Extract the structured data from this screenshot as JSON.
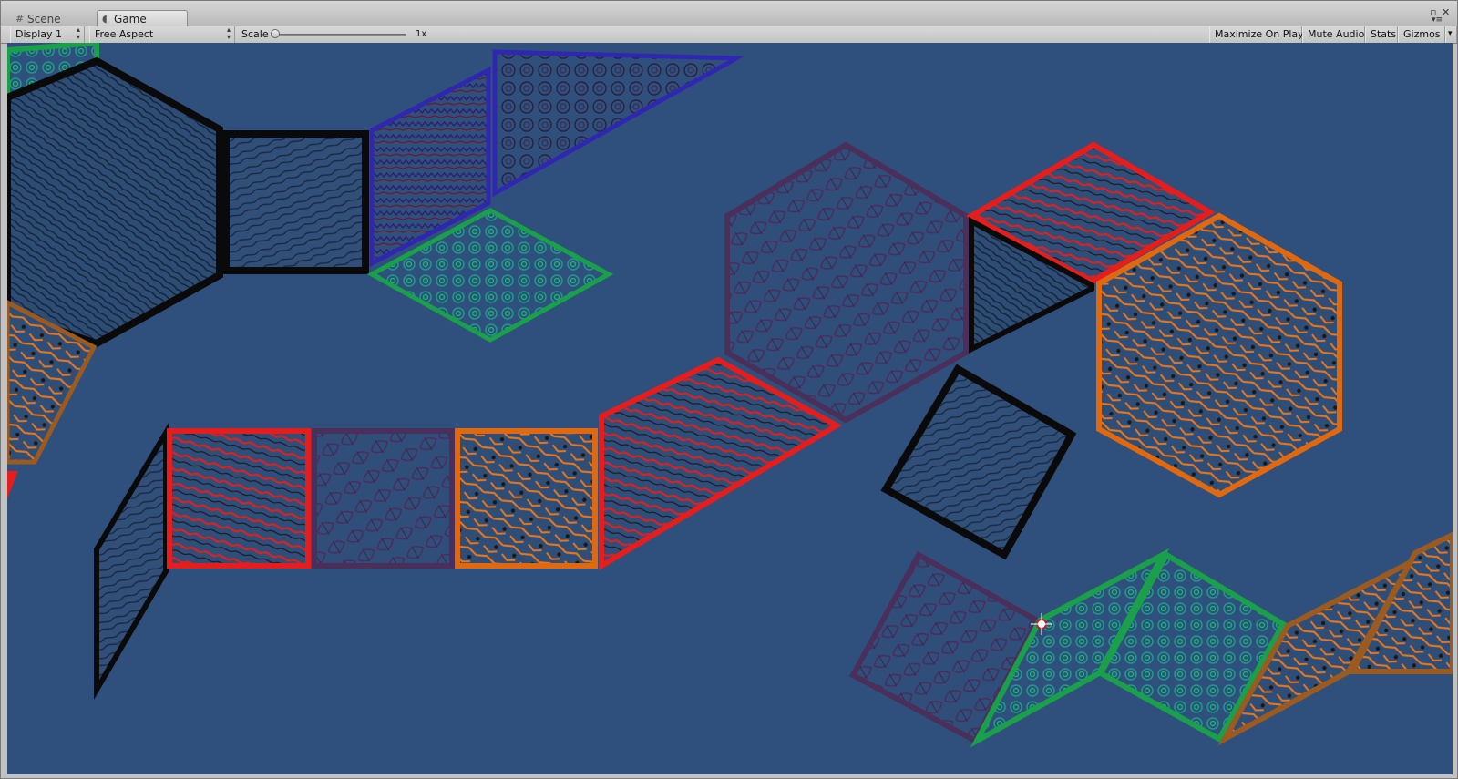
{
  "tabs": [
    {
      "label": "Scene",
      "icon": "grid-icon",
      "active": false
    },
    {
      "label": "Game",
      "icon": "pacman-icon",
      "active": true
    }
  ],
  "window_controls": {
    "maximize": "▫",
    "close": "✕",
    "menu": "▾≡"
  },
  "toolbar": {
    "display": "Display 1",
    "aspect": "Free Aspect",
    "scale_label": "Scale",
    "scale_value": "1x",
    "scale_fraction": 0.0,
    "maximize_on_play": "Maximize On Play",
    "mute_audio": "Mute Audio",
    "stats": "Stats",
    "gizmos": "Gizmos"
  },
  "game_view": {
    "background_color": "#2f507c",
    "tile_border_colors": {
      "black": "#0a0a0a",
      "red": "#e51d1d",
      "purple": "#4a2f5a",
      "orange": "#e0680f",
      "green": "#1aa04a",
      "blue": "#3027b0",
      "brown": "#9a5a20"
    }
  }
}
